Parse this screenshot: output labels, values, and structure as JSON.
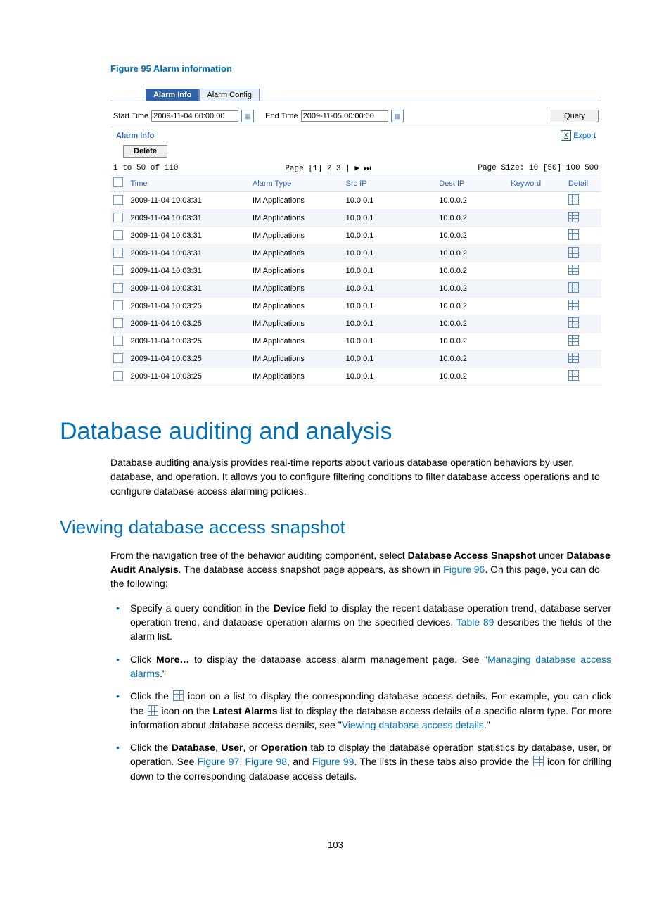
{
  "figure_caption": "Figure 95 Alarm information",
  "screenshot": {
    "tabs": {
      "active": "Alarm Info",
      "other": "Alarm Config"
    },
    "filter": {
      "start_label": "Start Time",
      "start_value": "2009-11-04 00:00:00",
      "end_label": "End Time",
      "end_value": "2009-11-05 00:00:00",
      "query_btn": "Query"
    },
    "section_title": "Alarm Info",
    "export_label": "Export",
    "delete_btn": "Delete",
    "pager": {
      "range": "1 to 50 of 110",
      "pages": "Page [1] 2 3 | ▶ ⏭",
      "size": "Page Size: 10 [50] 100 500"
    },
    "columns": {
      "time": "Time",
      "alarm_type": "Alarm Type",
      "src_ip": "Src IP",
      "dest_ip": "Dest IP",
      "keyword": "Keyword",
      "detail": "Detail"
    },
    "rows": [
      {
        "time": "2009-11-04 10:03:31",
        "type": "IM Applications",
        "src": "10.0.0.1",
        "dest": "10.0.0.2"
      },
      {
        "time": "2009-11-04 10:03:31",
        "type": "IM Applications",
        "src": "10.0.0.1",
        "dest": "10.0.0.2"
      },
      {
        "time": "2009-11-04 10:03:31",
        "type": "IM Applications",
        "src": "10.0.0.1",
        "dest": "10.0.0.2"
      },
      {
        "time": "2009-11-04 10:03:31",
        "type": "IM Applications",
        "src": "10.0.0.1",
        "dest": "10.0.0.2"
      },
      {
        "time": "2009-11-04 10:03:31",
        "type": "IM Applications",
        "src": "10.0.0.1",
        "dest": "10.0.0.2"
      },
      {
        "time": "2009-11-04 10:03:31",
        "type": "IM Applications",
        "src": "10.0.0.1",
        "dest": "10.0.0.2"
      },
      {
        "time": "2009-11-04 10:03:25",
        "type": "IM Applications",
        "src": "10.0.0.1",
        "dest": "10.0.0.2"
      },
      {
        "time": "2009-11-04 10:03:25",
        "type": "IM Applications",
        "src": "10.0.0.1",
        "dest": "10.0.0.2"
      },
      {
        "time": "2009-11-04 10:03:25",
        "type": "IM Applications",
        "src": "10.0.0.1",
        "dest": "10.0.0.2"
      },
      {
        "time": "2009-11-04 10:03:25",
        "type": "IM Applications",
        "src": "10.0.0.1",
        "dest": "10.0.0.2"
      },
      {
        "time": "2009-11-04 10:03:25",
        "type": "IM Applications",
        "src": "10.0.0.1",
        "dest": "10.0.0.2"
      }
    ]
  },
  "h1": "Database auditing and analysis",
  "p1": "Database auditing analysis provides real-time reports about various database operation behaviors by user, database, and operation. It allows you to configure filtering conditions to filter database access operations and to configure database access alarming policies.",
  "h2": "Viewing database access snapshot",
  "p2_a": "From the navigation tree of the behavior auditing component, select ",
  "p2_b": "Database Access Snapshot",
  "p2_c": " under ",
  "p2_d": "Database Audit Analysis",
  "p2_e": ". The database access snapshot page appears, as shown in ",
  "p2_f": "Figure 96",
  "p2_g": ". On this page, you can do the following:",
  "bullets": {
    "b1_a": "Specify a query condition in the ",
    "b1_b": "Device",
    "b1_c": " field to display the recent database operation trend, database server operation trend, and database operation alarms on the specified devices. ",
    "b1_d": "Table 89",
    "b1_e": " describes the fields of the alarm list.",
    "b2_a": "Click ",
    "b2_b": "More…",
    "b2_c": " to display the database access alarm management page. See \"",
    "b2_d": "Managing database access alarms",
    "b2_e": ".\"",
    "b3_a": "Click the ",
    "b3_b": " icon on a list to display the corresponding database access details. For example, you can click the ",
    "b3_c": " icon on the ",
    "b3_d": "Latest Alarms",
    "b3_e": " list to display the database access details of a specific alarm type. For more information about database access details, see \"",
    "b3_f": "Viewing database access details",
    "b3_g": ".\"",
    "b4_a": "Click the ",
    "b4_b": "Database",
    "b4_c": ", ",
    "b4_d": "User",
    "b4_e": ", or ",
    "b4_f": "Operation",
    "b4_g": " tab to display the database operation statistics by database, user, or operation. See ",
    "b4_h": "Figure 97",
    "b4_i": ", ",
    "b4_j": "Figure 98",
    "b4_k": ", and ",
    "b4_l": "Figure 99",
    "b4_m": ". The lists in these tabs also provide the ",
    "b4_n": " icon for drilling down to the corresponding database access details."
  },
  "page_number": "103"
}
